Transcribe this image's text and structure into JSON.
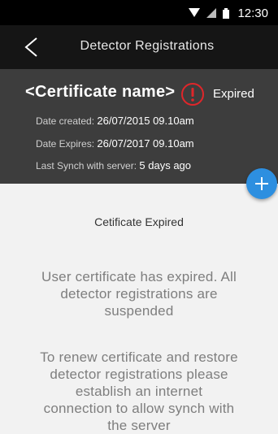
{
  "status_bar": {
    "time": "12:30",
    "icons": [
      "wifi-icon",
      "signal-icon",
      "battery-icon"
    ]
  },
  "app_bar": {
    "title": "Detector Registrations",
    "back_icon": "back-chevron-icon"
  },
  "certificate": {
    "name": "<Certificate name>",
    "status": "Expired",
    "status_icon": "alert-circle-icon",
    "date_created_label": "Date created:",
    "date_created_value": "26/07/2015 09.10am",
    "date_expires_label": "Date Expires:",
    "date_expires_value": "26/07/2017 09.10am",
    "last_synch_label": "Last Synch with server:",
    "last_synch_value": "5 days ago"
  },
  "fab": {
    "icon": "plus-icon"
  },
  "content": {
    "heading": "Cetificate Expired",
    "message_1_lines": [
      "User certificate has expired. All",
      "detector registrations are",
      "suspended"
    ],
    "message_2_lines": [
      "To renew certificate and restore",
      "detector registrations please",
      "establish an internet",
      "connection to allow synch with",
      "the server"
    ]
  },
  "colors": {
    "status_bar_bg": "#000000",
    "app_bar_bg": "#151515",
    "card_bg": "#3d3d3d",
    "alert_red": "#e0262a",
    "fab_blue": "#2d8fe0",
    "content_bg": "#f2f2f2"
  }
}
